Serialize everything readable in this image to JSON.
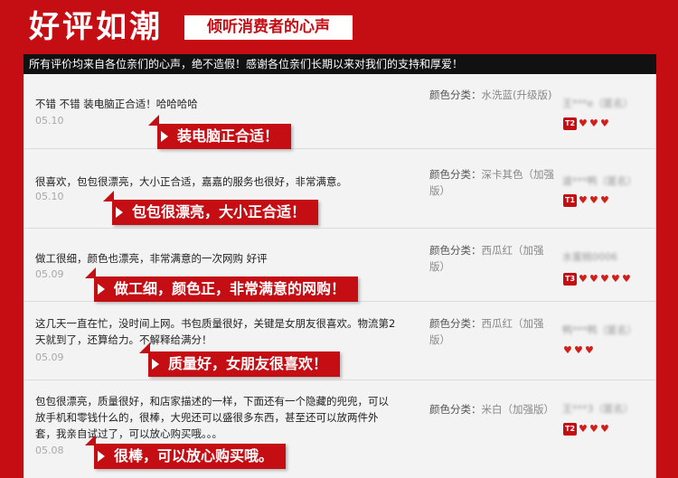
{
  "header": {
    "title": "好评如潮",
    "subtitle": "倾听消费者的心声",
    "notice": "所有评价均来自各位亲们的心声，绝不造假！感谢各位亲们长期以来对我们的支持和厚爱！"
  },
  "reviews": [
    {
      "comment": "不错 不错 装电脑正合适！哈哈哈哈",
      "date": "05.10",
      "highlight": "装电脑正合适！",
      "color_label": "颜色分类：",
      "color_value": "水洗蓝(升级版)",
      "user": "王***e（匿名）",
      "level": "T2",
      "hearts": 3
    },
    {
      "comment": "很喜欢，包包很漂亮，大小正合适，嘉嘉的服务也很好，非常满意。",
      "date": "05.10",
      "highlight": "包包很漂亮，大小正合适！",
      "color_label": "颜色分类：",
      "color_value": "深卡其色（加强版）",
      "user": "道***鸭（匿名）",
      "level": "T1",
      "hearts": 3
    },
    {
      "comment": "做工很细，颜色也漂亮，非常满意的一次网购 好评",
      "date": "05.09",
      "highlight": "做工细，颜色正，非常满意的网购！",
      "color_label": "颜色分类：",
      "color_value": "西瓜红（加强版）",
      "user": "水蜜桃0006",
      "level": "T3",
      "hearts": 5
    },
    {
      "comment": "这几天一直在忙，没时间上网。书包质量很好，关键是女朋友很喜欢。物流第2天就到了，还算给力。不解释给满分！",
      "date": "05.09",
      "highlight": "质量好，女朋友很喜欢！",
      "color_label": "颜色分类：",
      "color_value": "西瓜红（加强版）",
      "user": "鸭***鸭（匿名）",
      "level": "",
      "hearts": 3
    },
    {
      "comment": "包包很漂亮，质量很好，和店家描述的一样，下面还有一个隐藏的兜兜，可以放手机和零钱什么的，很棒，大兜还可以盛很多东西，甚至还可以放两件外套，我亲自试过了，可以放心购买哦。。。",
      "date": "05.08",
      "highlight": "很棒，可以放心购买哦。",
      "color_label": "颜色分类：",
      "color_value": "米白（加强版）",
      "user": "王***3（匿名）",
      "level": "T2",
      "hearts": 3
    }
  ]
}
